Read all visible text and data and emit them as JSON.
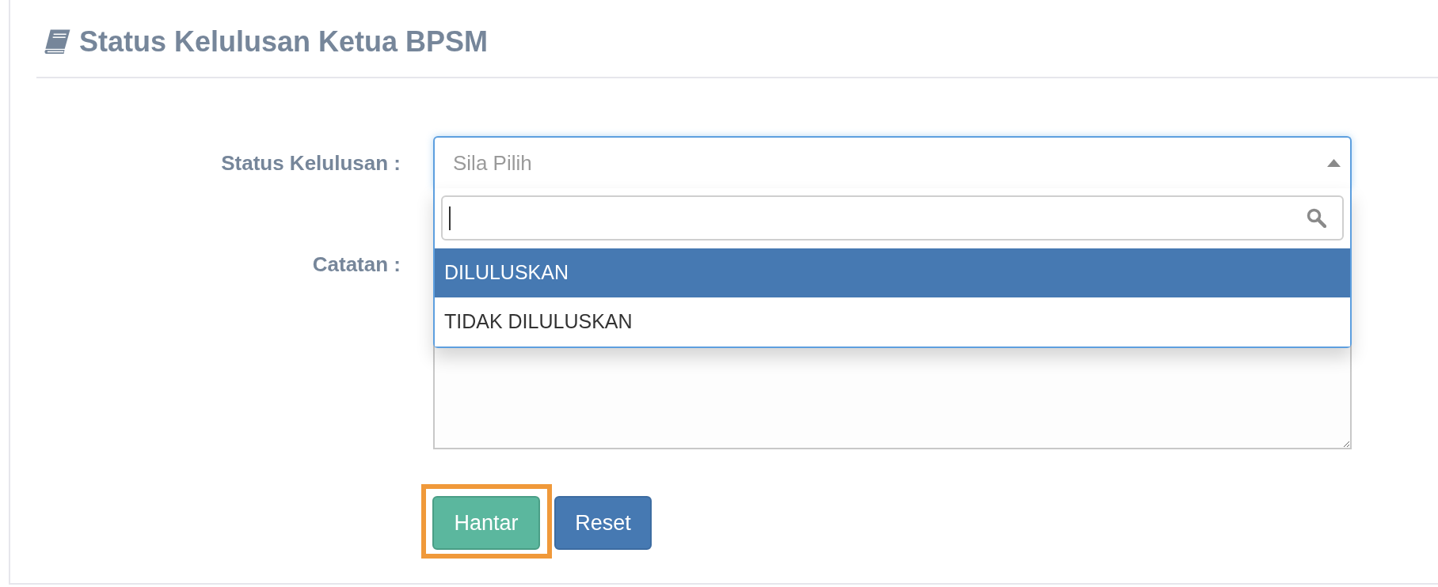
{
  "page": {
    "title": "Status Kelulusan Ketua BPSM"
  },
  "form": {
    "status_field": {
      "label": "Status Kelulusan :",
      "placeholder": "Sila Pilih",
      "expanded": true,
      "search": {
        "focused": true
      },
      "options": [
        {
          "label": "DILULUSKAN",
          "selected": true
        },
        {
          "label": "TIDAK DILULUSKAN",
          "selected": false
        }
      ]
    },
    "notes_field": {
      "label": "Catatan :"
    },
    "buttons": [
      {
        "label": "Hantar",
        "kind": "submit",
        "highlighted": true
      },
      {
        "label": "Reset",
        "kind": "reset",
        "highlighted": false
      }
    ]
  }
}
